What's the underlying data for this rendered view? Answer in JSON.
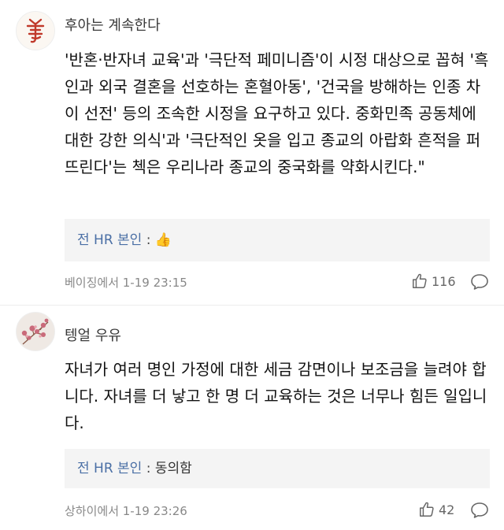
{
  "comments": [
    {
      "username": "후아는 계속한다",
      "avatar_icon": "seal-logo-icon",
      "text": "'반혼·반자녀 교육'과 '극단적 페미니즘'이 시정 대상으로 꼽혀 '흑인과 외국 결혼을 선호하는 혼혈아동', '건국을 방해하는 인종 차이 선전' 등의 조속한 시정을 요구하고 있다. 중화민족 공동체에 대한 강한 의식'과 '극단적인 옷을 입고 종교의 아랍화 흔적을 퍼뜨린다'는 첵은 우리나라 종교의 중국화를 약화시킨다.\"",
      "reply": {
        "user": "전 HR 본인",
        "separator": ":",
        "text": "",
        "emoji": "👍"
      },
      "location_time": "베이징에서 1-19 23:15",
      "likes": "116"
    },
    {
      "username": "텡얼 우유",
      "avatar_icon": "flower-avatar-icon",
      "text": "자녀가 여러 명인 가정에 대한 세금 감면이나 보조금을 늘려야 합니다. 자녀를 더 낳고 한 명 더 교육하는 것은 너무나 힘든 일입니다.",
      "reply": {
        "user": "전 HR 본인",
        "separator": " : ",
        "text": "동의함",
        "emoji": ""
      },
      "location_time": "상하이에서 1-19 23:26",
      "likes": "42"
    }
  ],
  "colors": {
    "reply_user": "#4a6fa5",
    "meta_gray": "#888888",
    "reply_bg": "#f4f4f4",
    "seal_red": "#c0392b"
  }
}
